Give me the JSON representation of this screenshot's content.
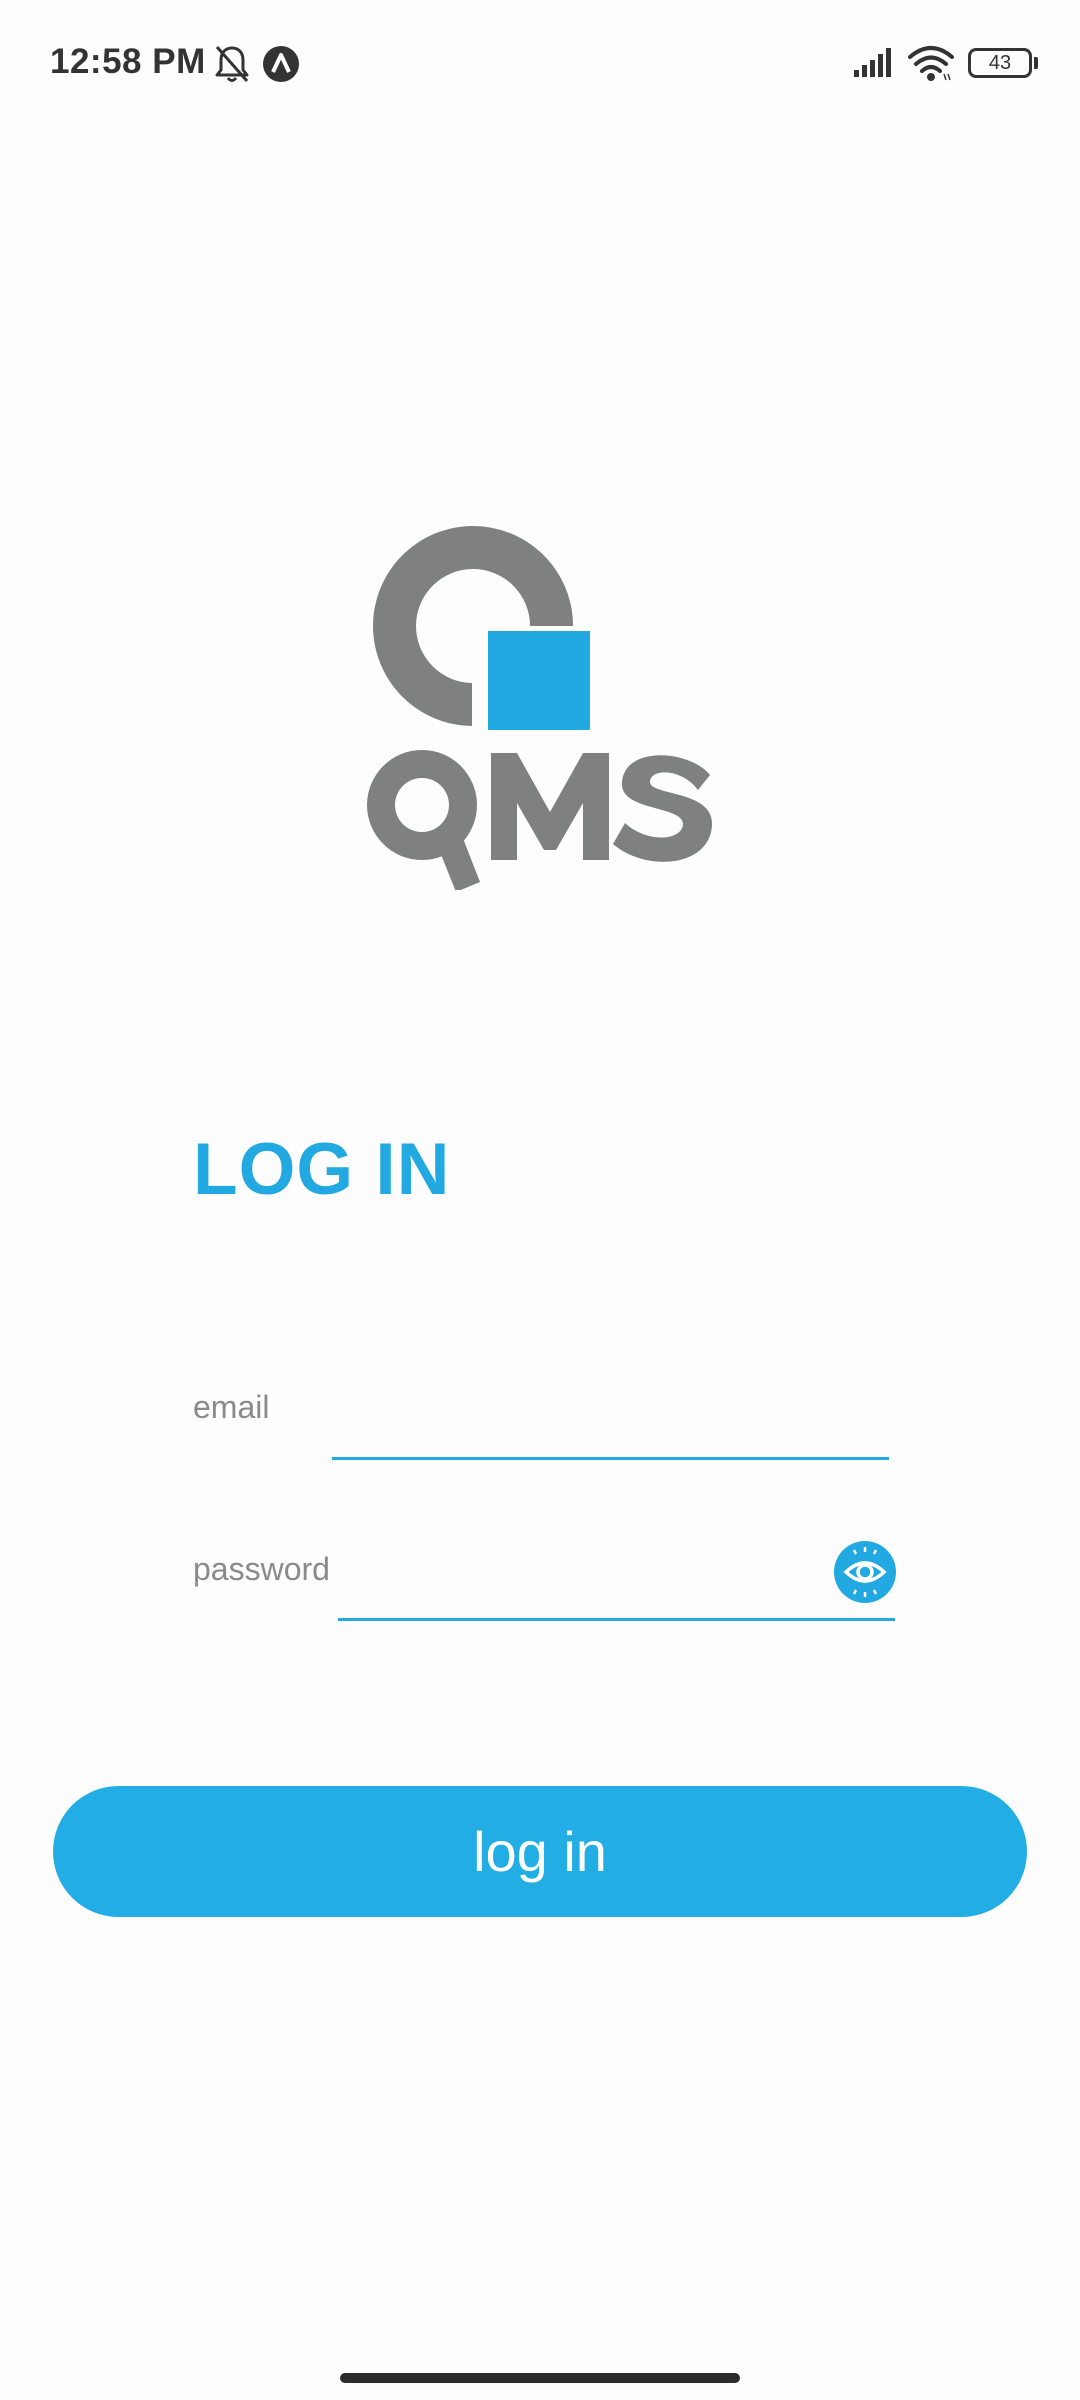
{
  "status_bar": {
    "time": "12:58 PM",
    "battery_level": "43",
    "icons": [
      "notifications-muted-icon",
      "app-notification-icon",
      "signal-icon",
      "wifi-icon",
      "battery-icon"
    ]
  },
  "logo": {
    "brand_name": "QMS",
    "colors": {
      "gray": "#7f8080",
      "blue": "#22a9e1"
    }
  },
  "login": {
    "title": "LOG IN",
    "email": {
      "label": "email",
      "value": ""
    },
    "password": {
      "label": "password",
      "value": "",
      "toggle_icon": "eye-icon"
    },
    "submit_label": "log in"
  },
  "theme": {
    "accent": "#22a9e1",
    "button": "#22ade4",
    "label_gray": "#8a8a8a",
    "background": "#fdfdfd"
  }
}
